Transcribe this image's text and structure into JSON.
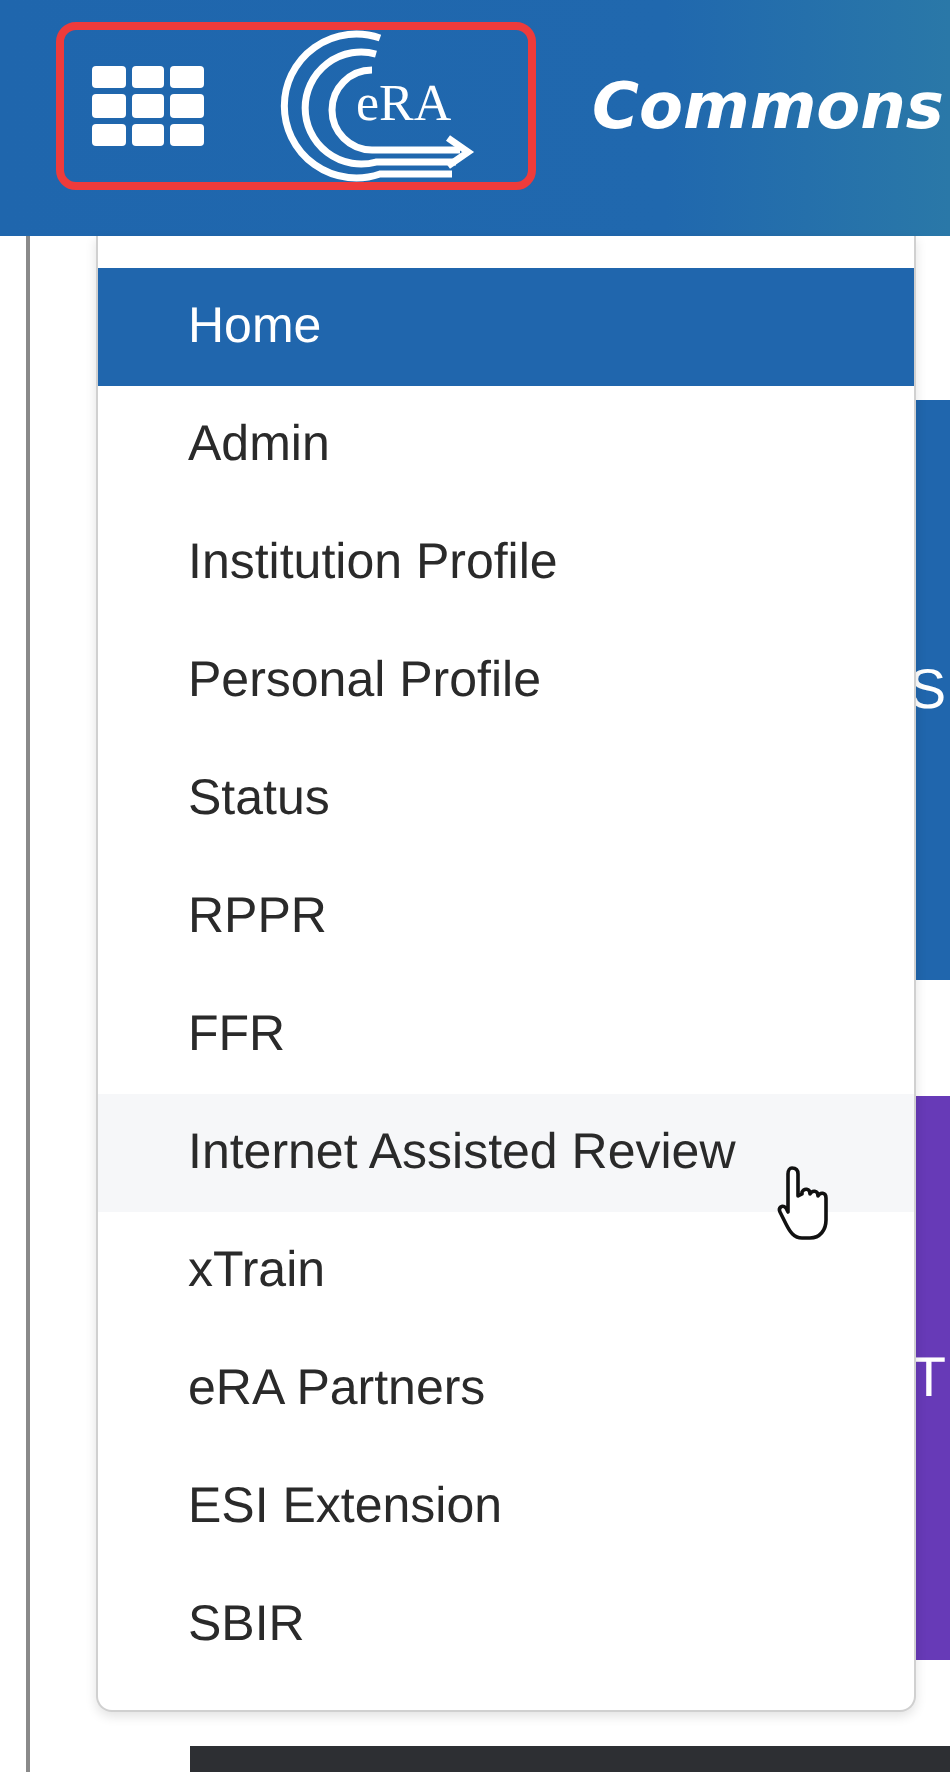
{
  "header": {
    "logo_text": "eRA",
    "title": "Commons",
    "highlighted": true
  },
  "menu": {
    "items": [
      {
        "label": "Home",
        "selected": true,
        "hovered": false
      },
      {
        "label": "Admin",
        "selected": false,
        "hovered": false
      },
      {
        "label": "Institution Profile",
        "selected": false,
        "hovered": false
      },
      {
        "label": "Personal Profile",
        "selected": false,
        "hovered": false
      },
      {
        "label": "Status",
        "selected": false,
        "hovered": false
      },
      {
        "label": "RPPR",
        "selected": false,
        "hovered": false
      },
      {
        "label": "FFR",
        "selected": false,
        "hovered": false
      },
      {
        "label": "Internet Assisted Review",
        "selected": false,
        "hovered": true
      },
      {
        "label": "xTrain",
        "selected": false,
        "hovered": false
      },
      {
        "label": "eRA Partners",
        "selected": false,
        "hovered": false
      },
      {
        "label": "ESI Extension",
        "selected": false,
        "hovered": false
      },
      {
        "label": "SBIR",
        "selected": false,
        "hovered": false
      }
    ]
  },
  "background": {
    "fragments": [
      {
        "text": "S",
        "color": "#2066ad"
      },
      {
        "text": "T",
        "color": "#673ab7"
      }
    ]
  }
}
